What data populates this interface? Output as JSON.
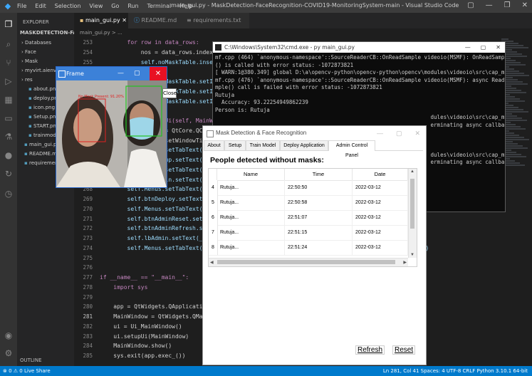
{
  "vscode": {
    "menu": [
      "File",
      "Edit",
      "Selection",
      "View",
      "Go",
      "Run",
      "Terminal",
      "Help"
    ],
    "title": "main_gui.py - MaskDetection-FaceRecognition-COVID19-MonitoringSystem-main - Visual Studio Code",
    "explorer_label": "EXPLORER",
    "project_label": "MASKDETECTION-FACERE...",
    "files": [
      {
        "name": "Databases",
        "type": "folder",
        "indent": 1
      },
      {
        "name": "Face",
        "type": "folder",
        "indent": 1
      },
      {
        "name": "Mask",
        "type": "folder",
        "indent": 1
      },
      {
        "name": "myvirt.aienv",
        "type": "folder",
        "indent": 1
      },
      {
        "name": "res",
        "type": "folder",
        "indent": 1
      },
      {
        "name": "about.png",
        "type": "file",
        "indent": 2
      },
      {
        "name": "deploy.png",
        "type": "file",
        "indent": 2
      },
      {
        "name": "icon.png",
        "type": "file",
        "indent": 2
      },
      {
        "name": "Setup.png",
        "type": "file",
        "indent": 2
      },
      {
        "name": "START.png",
        "type": "file",
        "indent": 2
      },
      {
        "name": "trainmodels",
        "type": "file",
        "indent": 2
      },
      {
        "name": "main_gui.py",
        "type": "file",
        "indent": 1
      },
      {
        "name": "README.md",
        "type": "file",
        "indent": 1
      },
      {
        "name": "requirements",
        "type": "file",
        "indent": 1
      }
    ],
    "outline_label": "OUTLINE",
    "tabs": [
      "main_gui.py",
      "README.md",
      "requirements.txt"
    ],
    "breadcrumb": "main_gui.py > ...",
    "line_numbers": [
      "253",
      "254",
      "255",
      "256",
      "257",
      "258",
      "259",
      "260",
      "261",
      "262",
      "263",
      "264",
      "265",
      "266",
      "267",
      "268",
      "269",
      "270",
      "271",
      "272",
      "273",
      "274",
      "275",
      "276",
      "277",
      "278",
      "279",
      "280",
      "281",
      "282",
      "283",
      "284",
      "285"
    ],
    "code_lines": [
      "        for row in data_rows:",
      "            nos = data_rows.index(row",
      "            self.noMaskTable.insertRo",
      "",
      "            self.noMaskTable.setItem(",
      "            self.noMaskTable.setItem(",
      "            self.noMaskTable.setItem(",
      "",
      "    def retranslateUi(self, MainWindo",
      "        _translate = QtCore.QCore",
      "        MainWindow.setWindowTitle",
      "        self.Menus.setTabText(sel",
      "        self.btnSetup.setText(_tr",
      "        self.Menus.setTabText(sel",
      "        self.btnTrain.setText(_tr",
      "        self.Menus.setTabText(sel",
      "        self.btnDeploy.setText(_t",
      "        self.Menus.setTabText(sel",
      "        self.btnAdminReset.setTex",
      "        self.btnAdminRefresh.setT",
      "        self.lbAdmin.setText(_tra",
      "        self.Menus.setTabText(sel                                                       Panel\"))",
      "",
      "",
      "if __name__ == \"__main__\":",
      "    import sys",
      "",
      "    app = QtWidgets.QApplication(",
      "    MainWindow = QtWidgets.QMainW",
      "    ui = Ui_MainWindow()",
      "    ui.setupUi(MainWindow)",
      "    MainWindow.show()",
      "    sys.exit(app.exec_())"
    ],
    "status_left": "⊗ 0 ⚠ 0    Live Share",
    "status_right": "Ln 281, Col 41   Spaces: 4   UTF-8   CRLF   Python   3.10.1 64-bit"
  },
  "cmd": {
    "title": "C:\\Windows\\System32\\cmd.exe - py  main_gui.py",
    "lines": [
      "mf.cpp (464) `anonymous-namespace'::SourceReaderCB::OnReadSample videoio(MSMF): OnReadSample",
      "() is called with error status: -1072873821",
      "[ WARN:1@380.349] global D:\\a\\opencv-python\\opencv-python\\opencv\\modules\\videoio\\src\\cap_msm",
      "mf.cpp (476) `anonymous-namespace'::SourceReaderCB::OnReadSample videoio(MSMF): async ReadSa",
      "mple() call is failed with error status: -1072873821",
      "Rutuja",
      "  Accuracy: 93.22254949862239",
      "Person is: Rutuja",
      "                                                                   dules\\videoio\\src\\cap_msm",
      "                                                                   erminating async callbac",
      "",
      "",
      "",
      "                                                                   dules\\videoio\\src\\cap_msm",
      "                                                                   erminating async callbac"
    ]
  },
  "frame": {
    "title": "Frame",
    "detection_label": "No Mask Present: 91.20%",
    "close_tooltip": "Close"
  },
  "app": {
    "title": "Mask Detection & Face Recognition",
    "tabs": [
      {
        "label": "About",
        "active": false
      },
      {
        "label": "Setup",
        "active": false
      },
      {
        "label": "Train Model",
        "active": false
      },
      {
        "label": "Deploy Application",
        "active": false
      },
      {
        "label": "Admin Control Panel",
        "active": true
      }
    ],
    "heading": "People detected without masks:",
    "columns": [
      "Name",
      "Time",
      "Date"
    ],
    "rows": [
      {
        "num": "4",
        "name": "Rutuja...",
        "time": "22:50:50",
        "date": "2022-03-12"
      },
      {
        "num": "5",
        "name": "Rutuja...",
        "time": "22:50:58",
        "date": "2022-03-12"
      },
      {
        "num": "6",
        "name": "Rutuja...",
        "time": "22:51:07",
        "date": "2022-03-12"
      },
      {
        "num": "7",
        "name": "Rutuja...",
        "time": "22:51:15",
        "date": "2022-03-12"
      },
      {
        "num": "8",
        "name": "Rutuja...",
        "time": "22:51:24",
        "date": "2022-03-12"
      }
    ],
    "refresh_label": "Refresh",
    "reset_label": "Reset"
  },
  "colors": {
    "keyword": "#c586c0",
    "self": "#569cd6",
    "func": "#dcdcaa",
    "statusbar": "#007acc",
    "detection_box": "#e02020",
    "face_box": "#22c422"
  }
}
